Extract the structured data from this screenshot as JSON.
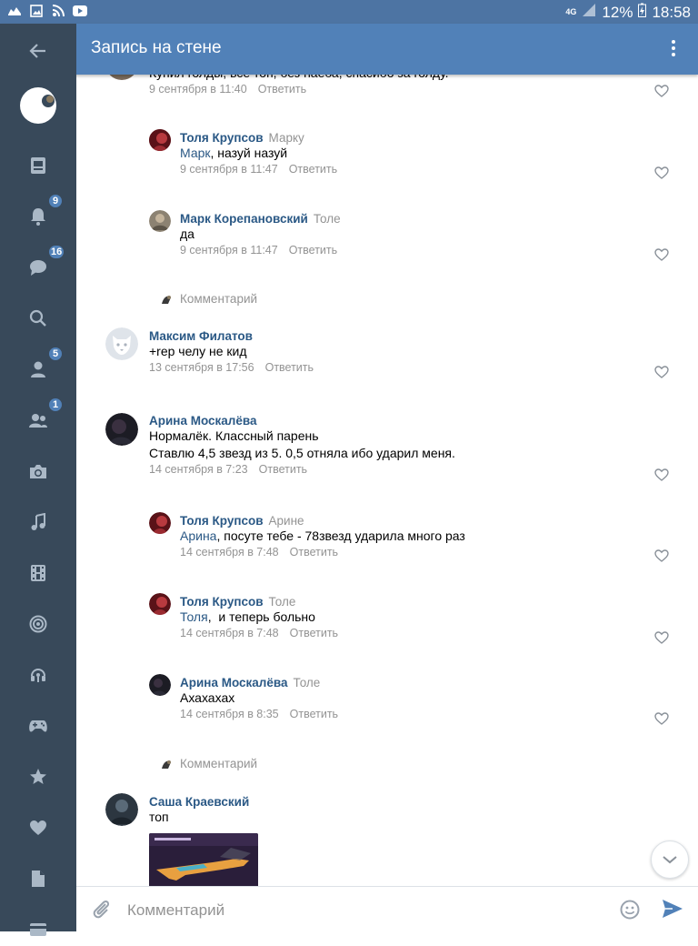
{
  "status_bar": {
    "network": "4G",
    "battery": "12%",
    "time": "18:58"
  },
  "header": {
    "title": "Запись на стене"
  },
  "sidebar": {
    "badges": {
      "notifications": "9",
      "messages": "16",
      "friends": "5",
      "groups": "1"
    }
  },
  "comments": {
    "c0": {
      "text": "Купил голды, все топ, без наеба, спасибо за голду.",
      "time": "9 сентября в 11:40",
      "reply_label": "Ответить"
    },
    "c1": {
      "name": "Толя Крупсов",
      "to": "Марку",
      "mention": "Марк",
      "text": ", назуй назуй",
      "time": "9 сентября в 11:47",
      "reply_label": "Ответить"
    },
    "c2": {
      "name": "Марк Корепановский",
      "to": "Толе",
      "text": "да",
      "time": "9 сентября в 11:47",
      "reply_label": "Ответить"
    },
    "c3": {
      "name": "Максим Филатов",
      "text": "+rep челу не кид",
      "time": "13 сентября в 17:56",
      "reply_label": "Ответить"
    },
    "c4": {
      "name": "Арина Москалёва",
      "text_line1": "Нормалёк. Классный парень",
      "text_line2": "Ставлю 4,5 звезд из 5. 0,5 отняла ибо ударил меня.",
      "time": "14 сентября в 7:23",
      "reply_label": "Ответить"
    },
    "c5": {
      "name": "Толя Крупсов",
      "to": "Арине",
      "mention": "Арина",
      "text": ", посуте тебе - 78звезд ударила много раз",
      "time": "14 сентября в 7:48",
      "reply_label": "Ответить"
    },
    "c6": {
      "name": "Толя Крупсов",
      "to": "Толе",
      "mention": "Толя",
      "text": ",  и теперь больно",
      "time": "14 сентября в 7:48",
      "reply_label": "Ответить"
    },
    "c7": {
      "name": "Арина Москалёва",
      "to": "Толе",
      "text": "Ахахахах",
      "time": "14 сентября в 8:35",
      "reply_label": "Ответить"
    },
    "c8": {
      "name": "Саша Краевский",
      "text": "топ"
    }
  },
  "add_comment_label": "Комментарий",
  "input": {
    "placeholder": "Комментарий"
  },
  "colors": {
    "header": "#5181b8",
    "sidebar": "#38495a",
    "link": "#2a5885"
  }
}
